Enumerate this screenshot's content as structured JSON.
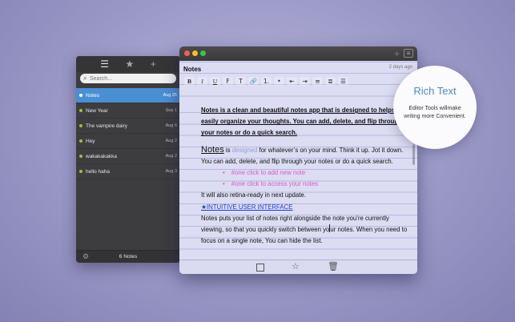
{
  "sidebar": {
    "toolbar": {
      "list_icon": "list-icon",
      "star_icon": "star-icon",
      "add_icon": "plus-icon"
    },
    "search": {
      "placeholder": "Search..."
    },
    "notes": [
      {
        "title": "Notes",
        "date": "Aug 25",
        "selected": true
      },
      {
        "title": "New Year",
        "date": "Sep 1",
        "selected": false
      },
      {
        "title": "The vampire dairy",
        "date": "Aug 6",
        "selected": false
      },
      {
        "title": "Hey",
        "date": "Aug 2",
        "selected": false
      },
      {
        "title": "wakakakakka",
        "date": "Aug 2",
        "selected": false
      },
      {
        "title": "hello haha",
        "date": "Aug 3",
        "selected": false
      }
    ],
    "footer": {
      "count": "6 Notes",
      "gear_icon": "gear-icon"
    }
  },
  "editor": {
    "doc_title": "Notes",
    "date_label": "2 days ago",
    "format_buttons": [
      "B",
      "I",
      "U",
      "F",
      "T",
      "🔗",
      "1.",
      "•",
      "⇤",
      "⇥",
      "≡",
      "≣",
      "☰"
    ],
    "content": {
      "intro": "Notes is a clean and beautiful notes app that is designed to helps you easily organize your thoughts.  You can add, delete, and flip through your notes or do a quick search.",
      "p1_word": "Notes",
      "p1_is": " is ",
      "p1_designed": "designed",
      "p1_rest": " for whatever’s on your mind. Think it up. Jot it down. You can add, delete, and flip through your notes or do a quick search.",
      "bullet1": "#one click to add new note",
      "bullet2": "#one click to access your notes",
      "retina": "It will also retina-ready in next update.",
      "link": "★INTUITIVE USER INTERFACE",
      "p2_a": "Notes puts your list of notes right alongside the note you’re currently viewing, so that you quickly switch between yo",
      "p2_b": "ur notes. When you need to focus on a single note, You can hide the list."
    },
    "footer_icons": [
      "checkbox-icon",
      "star-icon",
      "trash-icon"
    ]
  },
  "callout": {
    "title": "Rich Text",
    "text": "Editor Tools willmake writing more Convenient."
  },
  "colors": {
    "background": "#9a98c6",
    "selection": "#4b8fd3",
    "dot": "#8cc63f",
    "link": "#1e3fc7",
    "bullet": "#d75bc9",
    "callout_title": "#4f88c8"
  }
}
